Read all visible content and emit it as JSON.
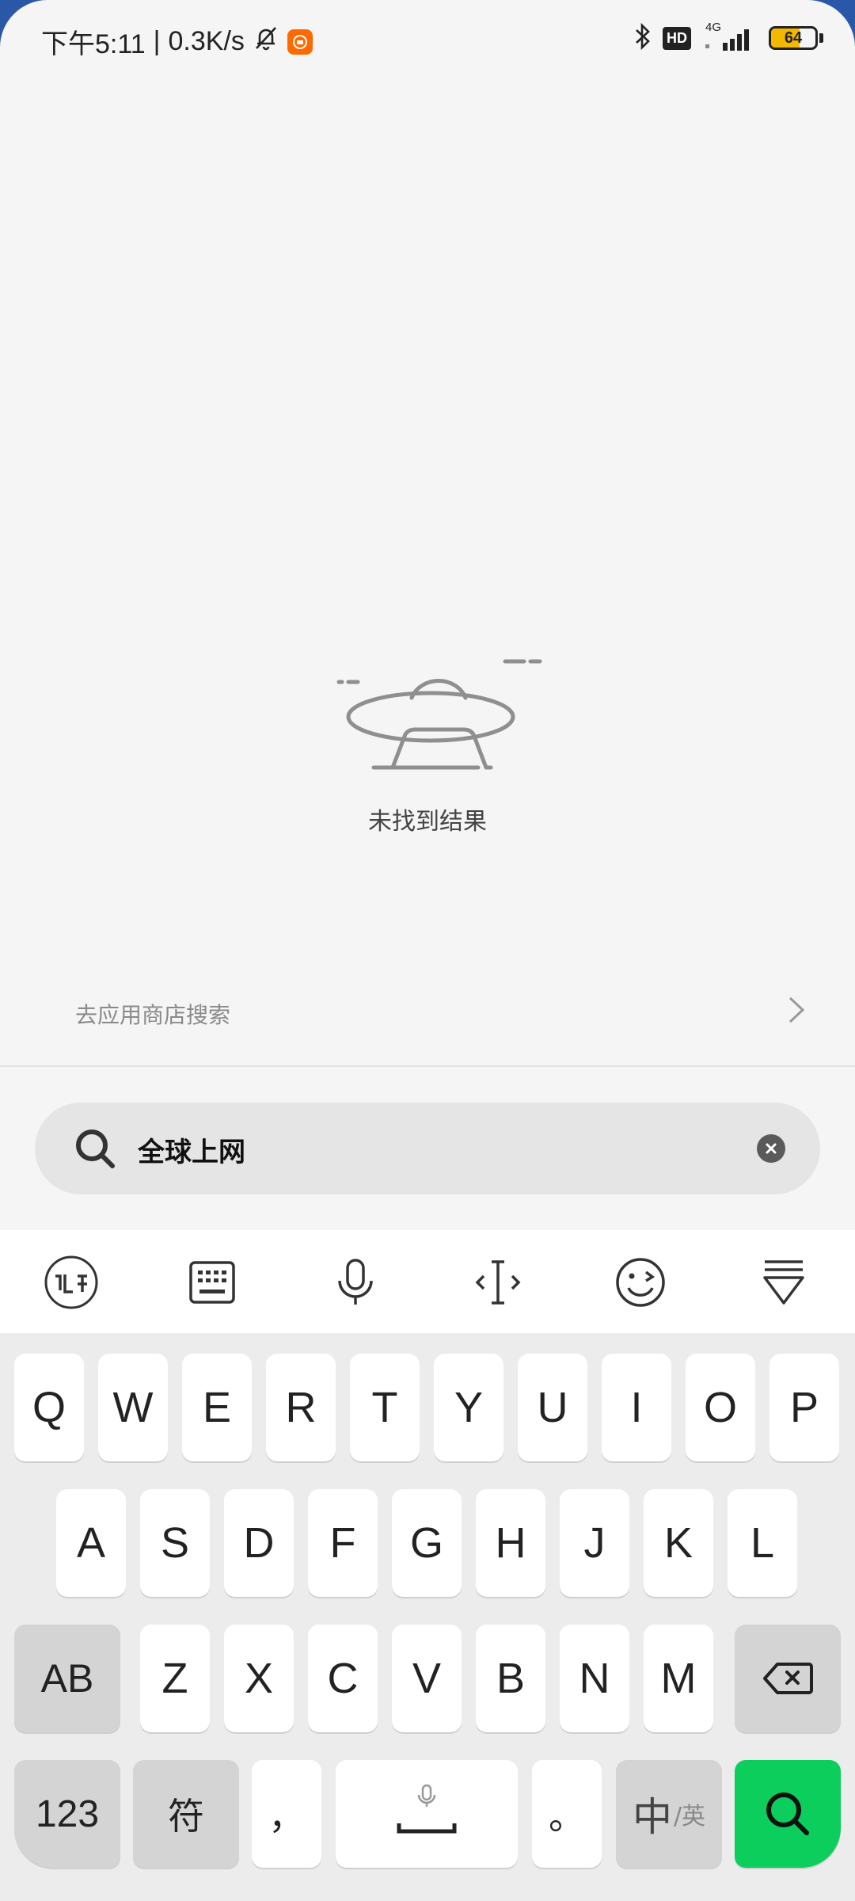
{
  "status_bar": {
    "time": "下午5:11",
    "separator": "|",
    "net_speed": "0.3K/s",
    "network_type": "4G",
    "hd_label": "HD",
    "battery_percent": "64",
    "icons": [
      "bell-off-icon",
      "mi-app-icon",
      "bluetooth-icon",
      "hd-icon",
      "signal-icon",
      "battery-icon"
    ]
  },
  "empty_state": {
    "icon": "ufo-icon",
    "message": "未找到结果"
  },
  "store_link": {
    "label": "去应用商店搜索",
    "icon": "chevron-right-icon"
  },
  "search": {
    "value": "全球上网",
    "icon": "search-icon",
    "clear_icon": "clear-icon"
  },
  "keyboard": {
    "toolbar": [
      "ifly-logo-icon",
      "keyboard-icon",
      "microphone-icon",
      "cursor-move-icon",
      "emoji-icon",
      "collapse-keyboard-icon"
    ],
    "row1": [
      "Q",
      "W",
      "E",
      "R",
      "T",
      "Y",
      "U",
      "I",
      "O",
      "P"
    ],
    "row2": [
      "A",
      "S",
      "D",
      "F",
      "G",
      "H",
      "J",
      "K",
      "L"
    ],
    "row3": [
      "Z",
      "X",
      "C",
      "V",
      "B",
      "N",
      "M"
    ],
    "shift_label": "AB",
    "num_label": "123",
    "symbol_label": "符",
    "comma_label": "，",
    "period_label": "。",
    "lang_label": "中",
    "lang_alt_label": "/英",
    "colors": {
      "search_key": "#0bce5c",
      "function_key": "#d4d4d4"
    }
  }
}
